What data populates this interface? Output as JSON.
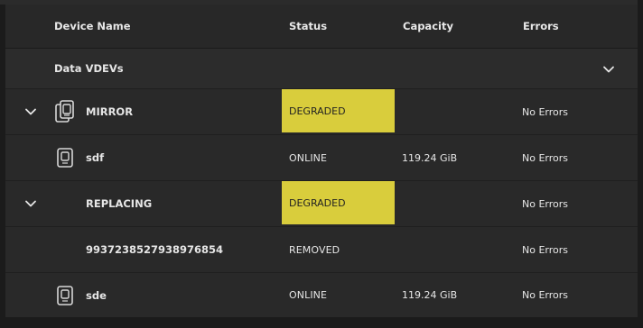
{
  "columns": {
    "device_name": "Device Name",
    "status": "Status",
    "capacity": "Capacity",
    "errors": "Errors"
  },
  "group": {
    "label": "Data VDEVs",
    "chevron_icon": "chevron-down-icon"
  },
  "rows": [
    {
      "name": "MIRROR",
      "status": "DEGRADED",
      "capacity": "",
      "errors": "No Errors"
    },
    {
      "name": "sdf",
      "status": "ONLINE",
      "capacity": "119.24 GiB",
      "errors": "No Errors"
    },
    {
      "name": "REPLACING",
      "status": "DEGRADED",
      "capacity": "",
      "errors": "No Errors"
    },
    {
      "name": "9937238527938976854",
      "status": "REMOVED",
      "capacity": "",
      "errors": "No Errors"
    },
    {
      "name": "sde",
      "status": "ONLINE",
      "capacity": "119.24 GiB",
      "errors": "No Errors"
    }
  ],
  "colors": {
    "degraded_badge": "#d9cd3c",
    "background": "#282828"
  }
}
